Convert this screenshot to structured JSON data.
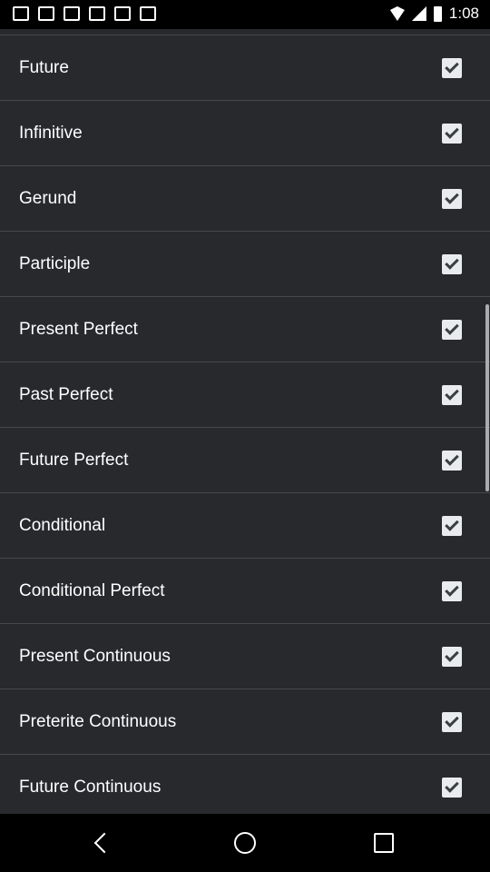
{
  "status_bar": {
    "time": "1:08"
  },
  "settings": {
    "items": [
      {
        "label": "Future",
        "checked": true
      },
      {
        "label": "Infinitive",
        "checked": true
      },
      {
        "label": "Gerund",
        "checked": true
      },
      {
        "label": "Participle",
        "checked": true
      },
      {
        "label": "Present Perfect",
        "checked": true
      },
      {
        "label": "Past Perfect",
        "checked": true
      },
      {
        "label": "Future Perfect",
        "checked": true
      },
      {
        "label": "Conditional",
        "checked": true
      },
      {
        "label": "Conditional Perfect",
        "checked": true
      },
      {
        "label": "Present Continuous",
        "checked": true
      },
      {
        "label": "Preterite Continuous",
        "checked": true
      },
      {
        "label": "Future Continuous",
        "checked": true
      }
    ]
  },
  "icons": {
    "checkbox": "check-icon",
    "back": "back-icon",
    "home": "home-icon",
    "recent": "recent-apps-icon"
  }
}
